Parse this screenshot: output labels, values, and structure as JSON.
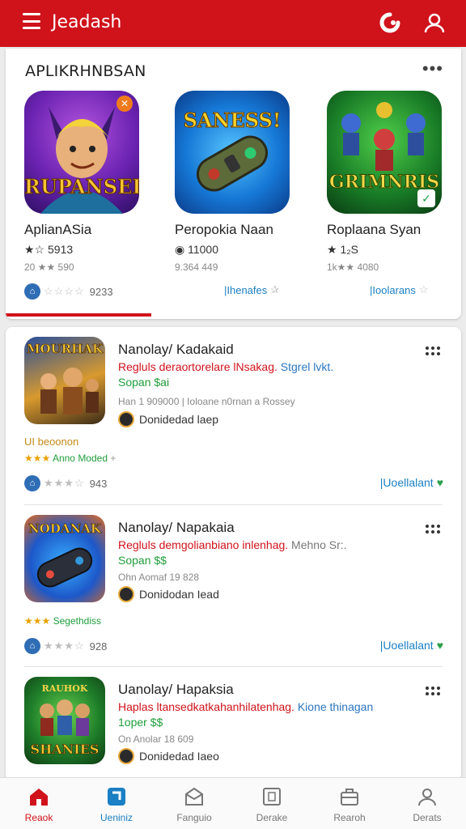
{
  "header": {
    "title": "Jeadash",
    "colors": {
      "brand": "#d0121b",
      "link": "#1a7fc4",
      "price": "#1e9d3a"
    }
  },
  "featured": {
    "title": "APLIKRHNBSAN",
    "apps": [
      {
        "name": "AplianASia",
        "art": "RUPANSEI",
        "rating": "★☆ 5913",
        "sub": "20 ★★ 590",
        "foot_text": "",
        "foot_count": "9233"
      },
      {
        "name": "Peropokia Naan",
        "art": "SANESS!",
        "rating": "◉ 11000",
        "sub": "9.364 449",
        "foot_text": "|Ihenafes",
        "foot_count": ""
      },
      {
        "name": "Roplaana Syan",
        "art": "GRIMNRIS",
        "rating": "★ 1₂S",
        "sub": "1k★★ 4080",
        "foot_text": "|Ioolarans",
        "foot_count": ""
      }
    ]
  },
  "list": [
    {
      "title": "Nanolay/ Kadakaid",
      "desc_red": "Regluls deraortorelare lNsakag.",
      "desc_blue": "Stgrel lvkt.",
      "price": "Sopan $ai",
      "meta": "Han 1 909000   |  Ioloane n0rnan a Rossey",
      "dev": "Donidedad laep",
      "art": "MOURHAK",
      "extra": "UI beoonon",
      "extra2": "Anno Moded",
      "rating_count": "943",
      "install": "|Uoellalant"
    },
    {
      "title": "Nanolay/ Napakaia",
      "desc_red": "Regluls demgolianbiano inlenhag.",
      "desc_grey": "Mehno Sr:.",
      "price": "Sopan $$",
      "meta": "Ohn Aomaf 19 828",
      "dev": "Donidodan Iead",
      "art": "NODANAK",
      "extra": "",
      "extra2": "Segethdiss",
      "rating_count": "928",
      "install": "|Uoellalant"
    },
    {
      "title": "Uanolay/ Hapaksia",
      "desc_red": "Haplas ltansedkatkahanhilatenhag.",
      "desc_blue": "Kione thinagan",
      "price": "1oper $$",
      "meta": "On Anolar 18 609",
      "dev": "Donidedad Iaeo",
      "art": "SHANIES",
      "extra": "",
      "extra2": "",
      "rating_count": "",
      "install": ""
    }
  ],
  "nav": [
    {
      "label": "Reaok",
      "icon": "home-icon"
    },
    {
      "label": "Ueniniz",
      "icon": "apps-icon"
    },
    {
      "label": "Fanguio",
      "icon": "games-icon"
    },
    {
      "label": "Derake",
      "icon": "list-icon"
    },
    {
      "label": "Rearoh",
      "icon": "briefcase-icon"
    },
    {
      "label": "Derats",
      "icon": "person-icon"
    }
  ]
}
